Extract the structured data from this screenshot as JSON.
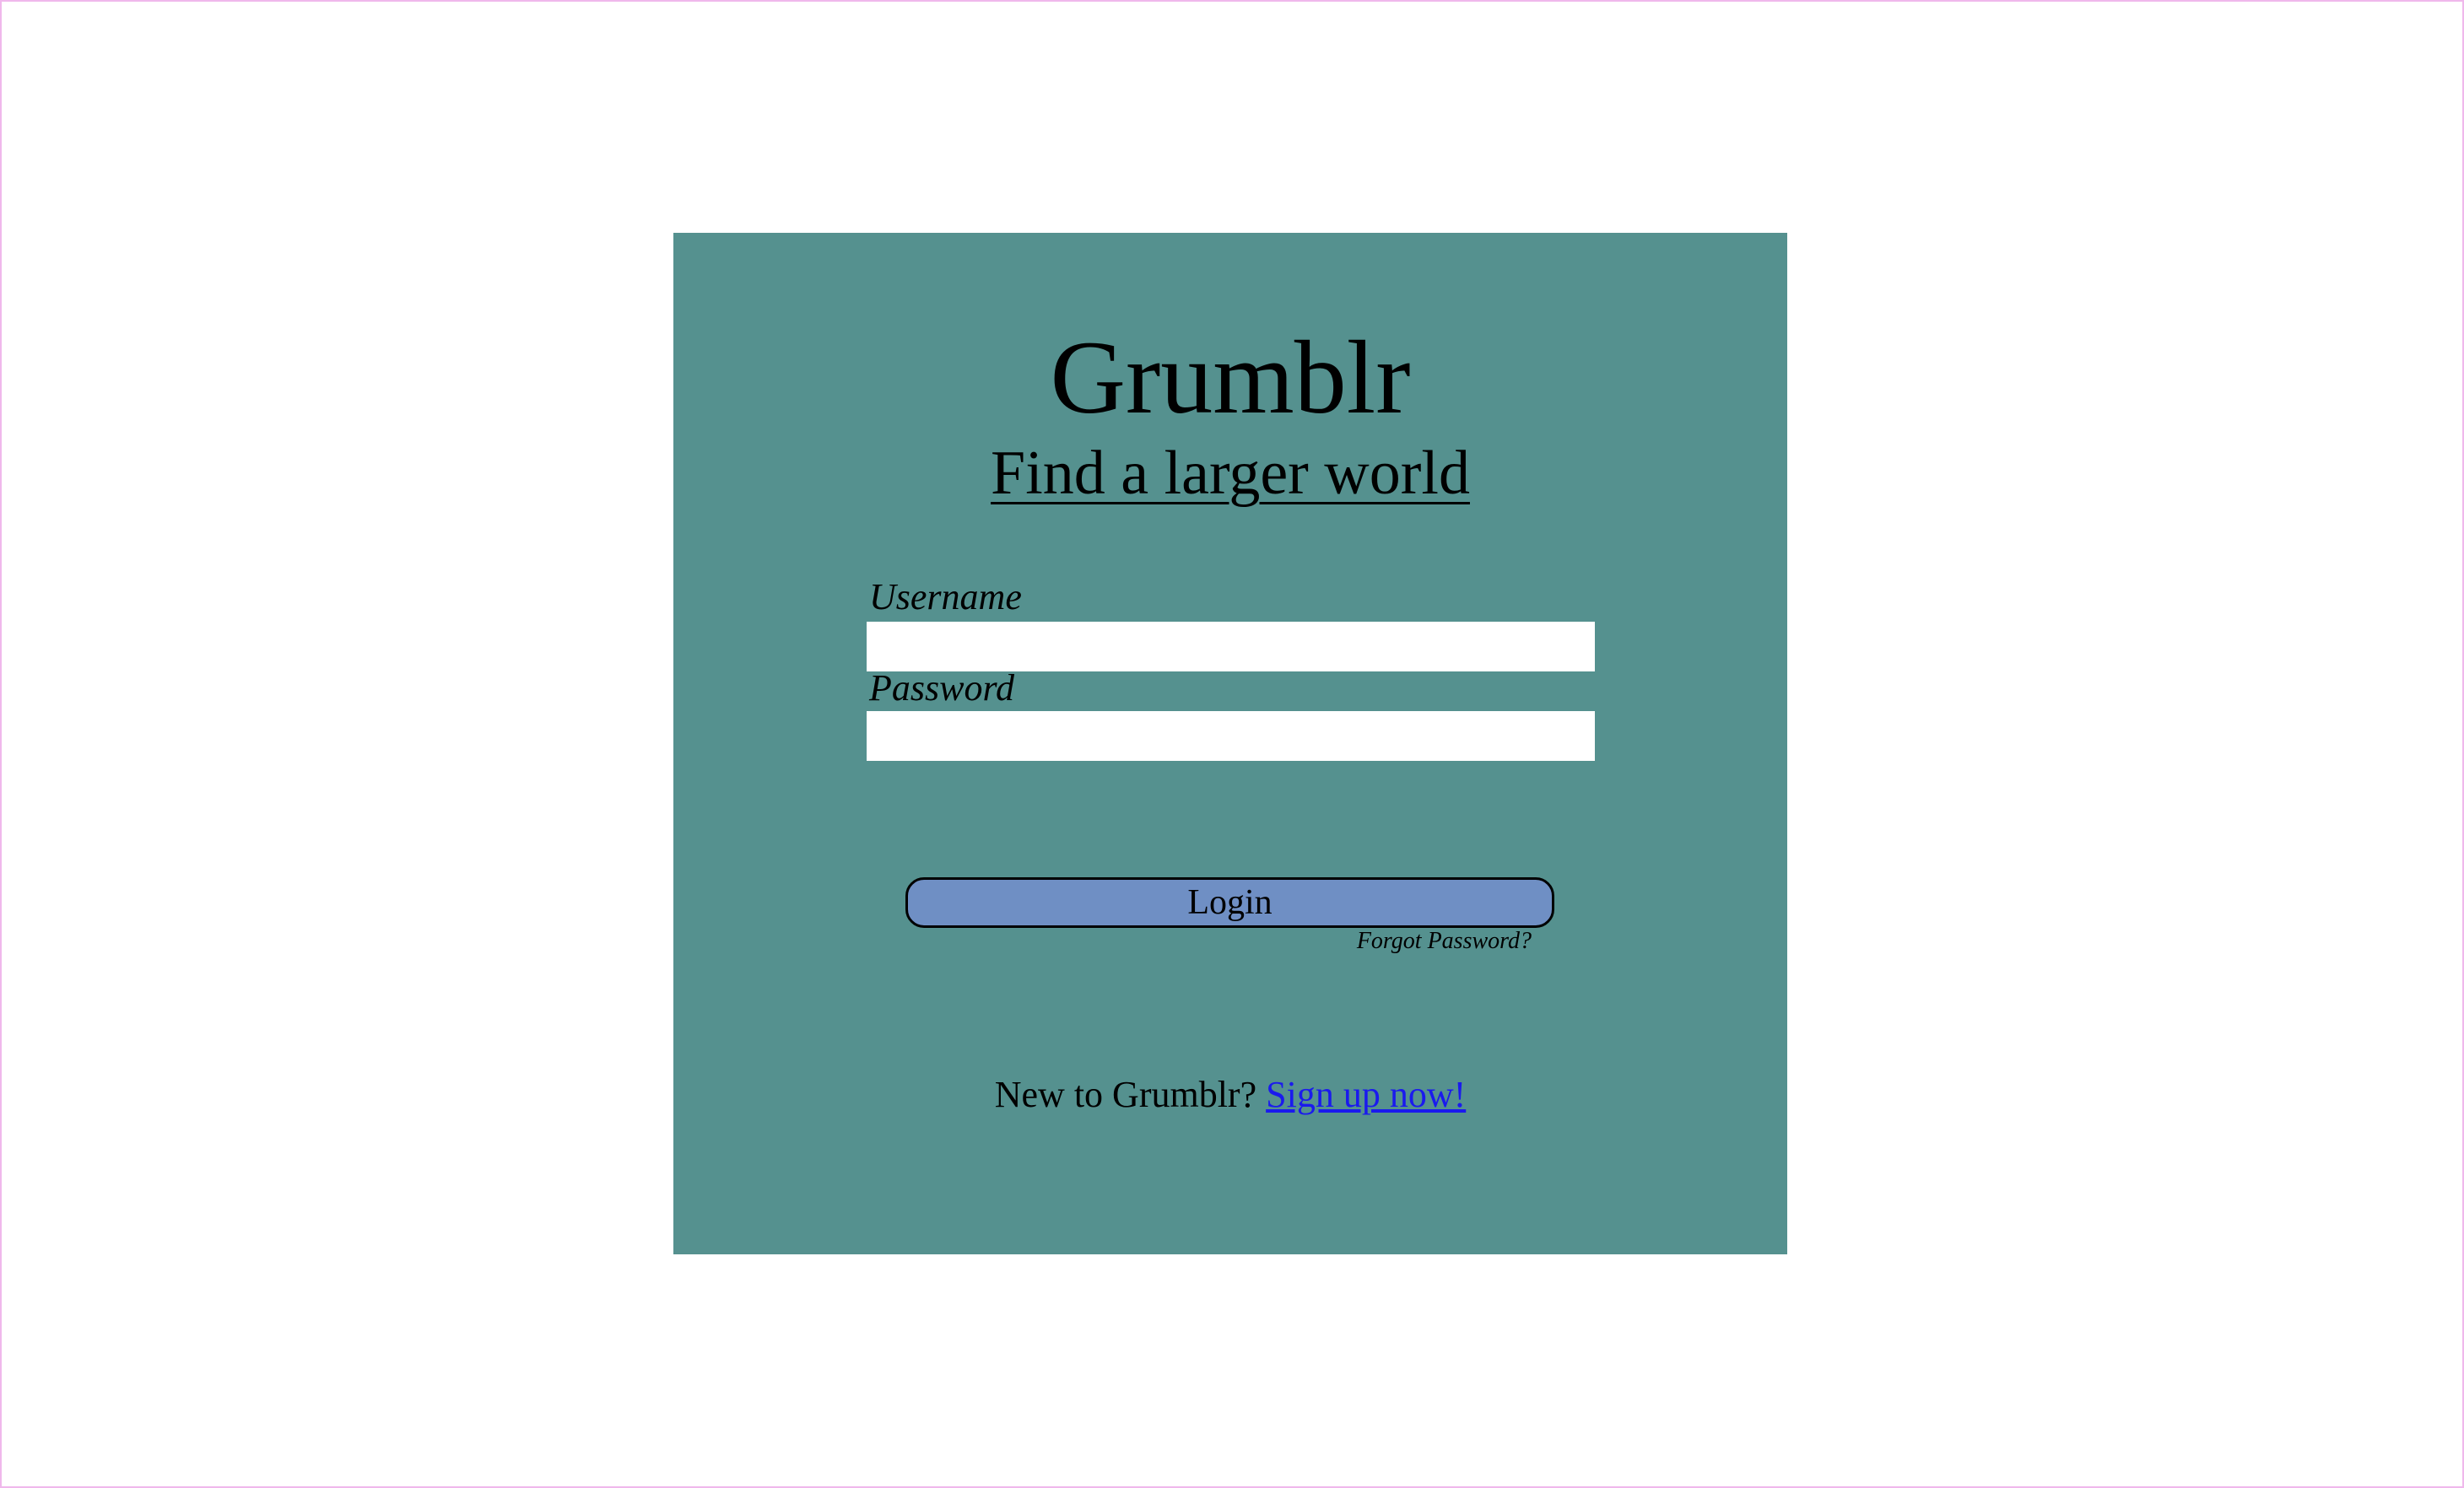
{
  "app": {
    "title": "Grumblr",
    "tagline": "Find a larger world"
  },
  "form": {
    "username_label": "Username",
    "username_value": "",
    "password_label": "Password",
    "password_value": "",
    "login_label": "Login",
    "forgot_label": "Forgot Password?"
  },
  "footer": {
    "prompt": "New to Grumblr?",
    "signup_label": "Sign up now!"
  },
  "colors": {
    "card_background": "#55918f",
    "button_background": "#6f8fc4",
    "link": "#1a1aee",
    "page_border": "#f0b8ec"
  }
}
